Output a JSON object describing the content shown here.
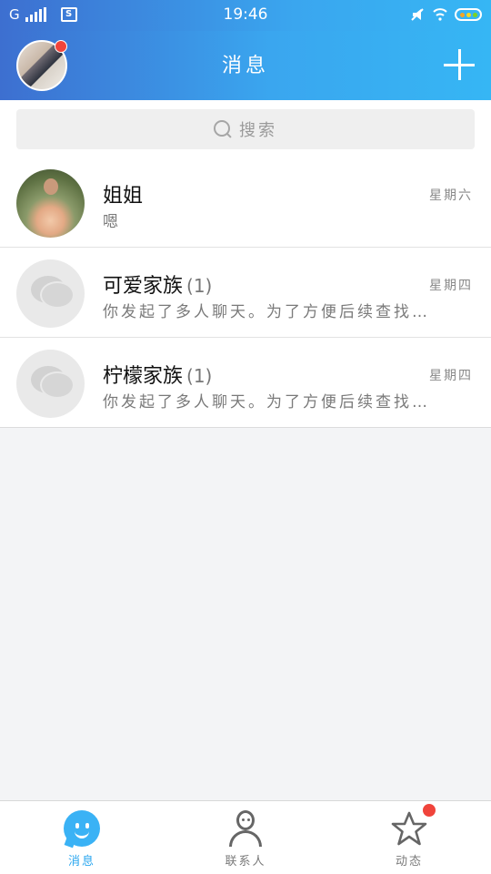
{
  "status_bar": {
    "network": "G",
    "time": "19:46",
    "sd_label": "S",
    "colors": {
      "battery_dots": [
        "#f5a623",
        "#f5d623",
        "#7ed321"
      ]
    }
  },
  "header": {
    "title": "消息",
    "add_icon": "plus-icon",
    "colors": {
      "gradient_start": "#3d6fd0",
      "gradient_end": "#36b6f4",
      "badge": "#f0443b"
    }
  },
  "search": {
    "placeholder": "搜索",
    "icon": "search-icon"
  },
  "conversations": [
    {
      "name": "姐姐",
      "count": "",
      "time": "星期六",
      "preview": "嗯",
      "avatar": "photo-avatar"
    },
    {
      "name": "可爱家族",
      "count": "(1)",
      "time": "星期四",
      "preview": "你发起了多人聊天。为了方便后续查找…",
      "avatar": "group-chat-icon"
    },
    {
      "name": "柠檬家族",
      "count": "(1)",
      "time": "星期四",
      "preview": "你发起了多人聊天。为了方便后续查找…",
      "avatar": "group-chat-icon"
    }
  ],
  "tabbar": {
    "tabs": [
      {
        "label": "消息",
        "icon": "message-icon",
        "active": true
      },
      {
        "label": "联系人",
        "icon": "contacts-icon",
        "active": false
      },
      {
        "label": "动态",
        "icon": "star-icon",
        "active": false,
        "badge": true
      }
    ],
    "colors": {
      "active": "#2aa6ef",
      "inactive": "#7a7a7a"
    }
  }
}
